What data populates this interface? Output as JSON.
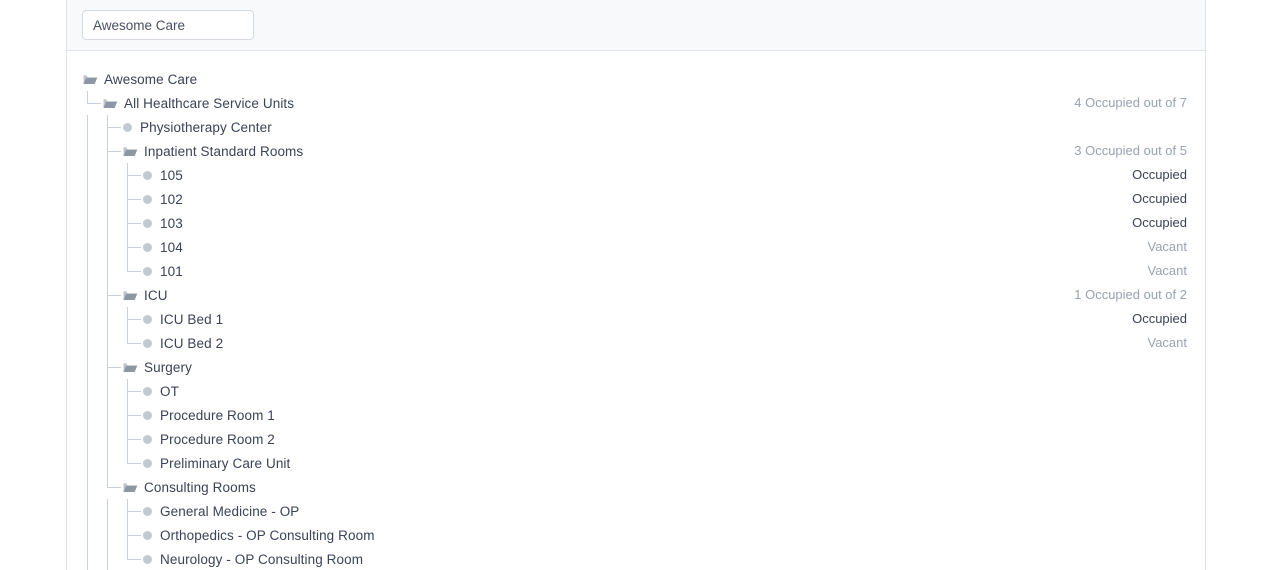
{
  "search": {
    "value": "Awesome Care",
    "placeholder": "Search"
  },
  "colors": {
    "text_dark": "#3c4257",
    "text_muted": "#98a2b1",
    "line": "#ccd2d9",
    "header_bg": "#f7f9fb",
    "border": "#dfe3e8",
    "dot": "#c3c9d1",
    "folder": "#8d97a5"
  },
  "tree": {
    "rows": [
      {
        "label": "Awesome Care",
        "depth": 0,
        "type": "folder",
        "status": "",
        "status_style": "none"
      },
      {
        "label": "All Healthcare Service Units",
        "depth": 1,
        "type": "folder",
        "status": "4 Occupied out of 7",
        "status_style": "muted"
      },
      {
        "label": "Physiotherapy Center",
        "depth": 2,
        "type": "leaf",
        "status": "",
        "status_style": "none"
      },
      {
        "label": "Inpatient Standard Rooms",
        "depth": 2,
        "type": "folder",
        "status": "3 Occupied out of 5",
        "status_style": "muted"
      },
      {
        "label": "105",
        "depth": 3,
        "type": "leaf",
        "status": "Occupied",
        "status_style": "dark"
      },
      {
        "label": "102",
        "depth": 3,
        "type": "leaf",
        "status": "Occupied",
        "status_style": "dark"
      },
      {
        "label": "103",
        "depth": 3,
        "type": "leaf",
        "status": "Occupied",
        "status_style": "dark"
      },
      {
        "label": "104",
        "depth": 3,
        "type": "leaf",
        "status": "Vacant",
        "status_style": "muted"
      },
      {
        "label": "101",
        "depth": 3,
        "type": "leaf",
        "status": "Vacant",
        "status_style": "muted"
      },
      {
        "label": "ICU",
        "depth": 2,
        "type": "folder",
        "status": "1 Occupied out of 2",
        "status_style": "muted"
      },
      {
        "label": "ICU Bed 1",
        "depth": 3,
        "type": "leaf",
        "status": "Occupied",
        "status_style": "dark"
      },
      {
        "label": "ICU Bed 2",
        "depth": 3,
        "type": "leaf",
        "status": "Vacant",
        "status_style": "muted"
      },
      {
        "label": "Surgery",
        "depth": 2,
        "type": "folder",
        "status": "",
        "status_style": "none"
      },
      {
        "label": "OT",
        "depth": 3,
        "type": "leaf",
        "status": "",
        "status_style": "none"
      },
      {
        "label": "Procedure Room 1",
        "depth": 3,
        "type": "leaf",
        "status": "",
        "status_style": "none"
      },
      {
        "label": "Procedure Room 2",
        "depth": 3,
        "type": "leaf",
        "status": "",
        "status_style": "none"
      },
      {
        "label": "Preliminary Care Unit",
        "depth": 3,
        "type": "leaf",
        "status": "",
        "status_style": "none"
      },
      {
        "label": "Consulting Rooms",
        "depth": 2,
        "type": "folder",
        "status": "",
        "status_style": "none"
      },
      {
        "label": "General Medicine - OP",
        "depth": 3,
        "type": "leaf",
        "status": "",
        "status_style": "none"
      },
      {
        "label": "Orthopedics - OP Consulting Room",
        "depth": 3,
        "type": "leaf",
        "status": "",
        "status_style": "none"
      },
      {
        "label": "Neurology - OP Consulting Room",
        "depth": 3,
        "type": "leaf",
        "status": "",
        "status_style": "none"
      }
    ]
  },
  "icons": {
    "folder": "open-folder-icon",
    "leaf": "tree-node-dot-icon"
  }
}
